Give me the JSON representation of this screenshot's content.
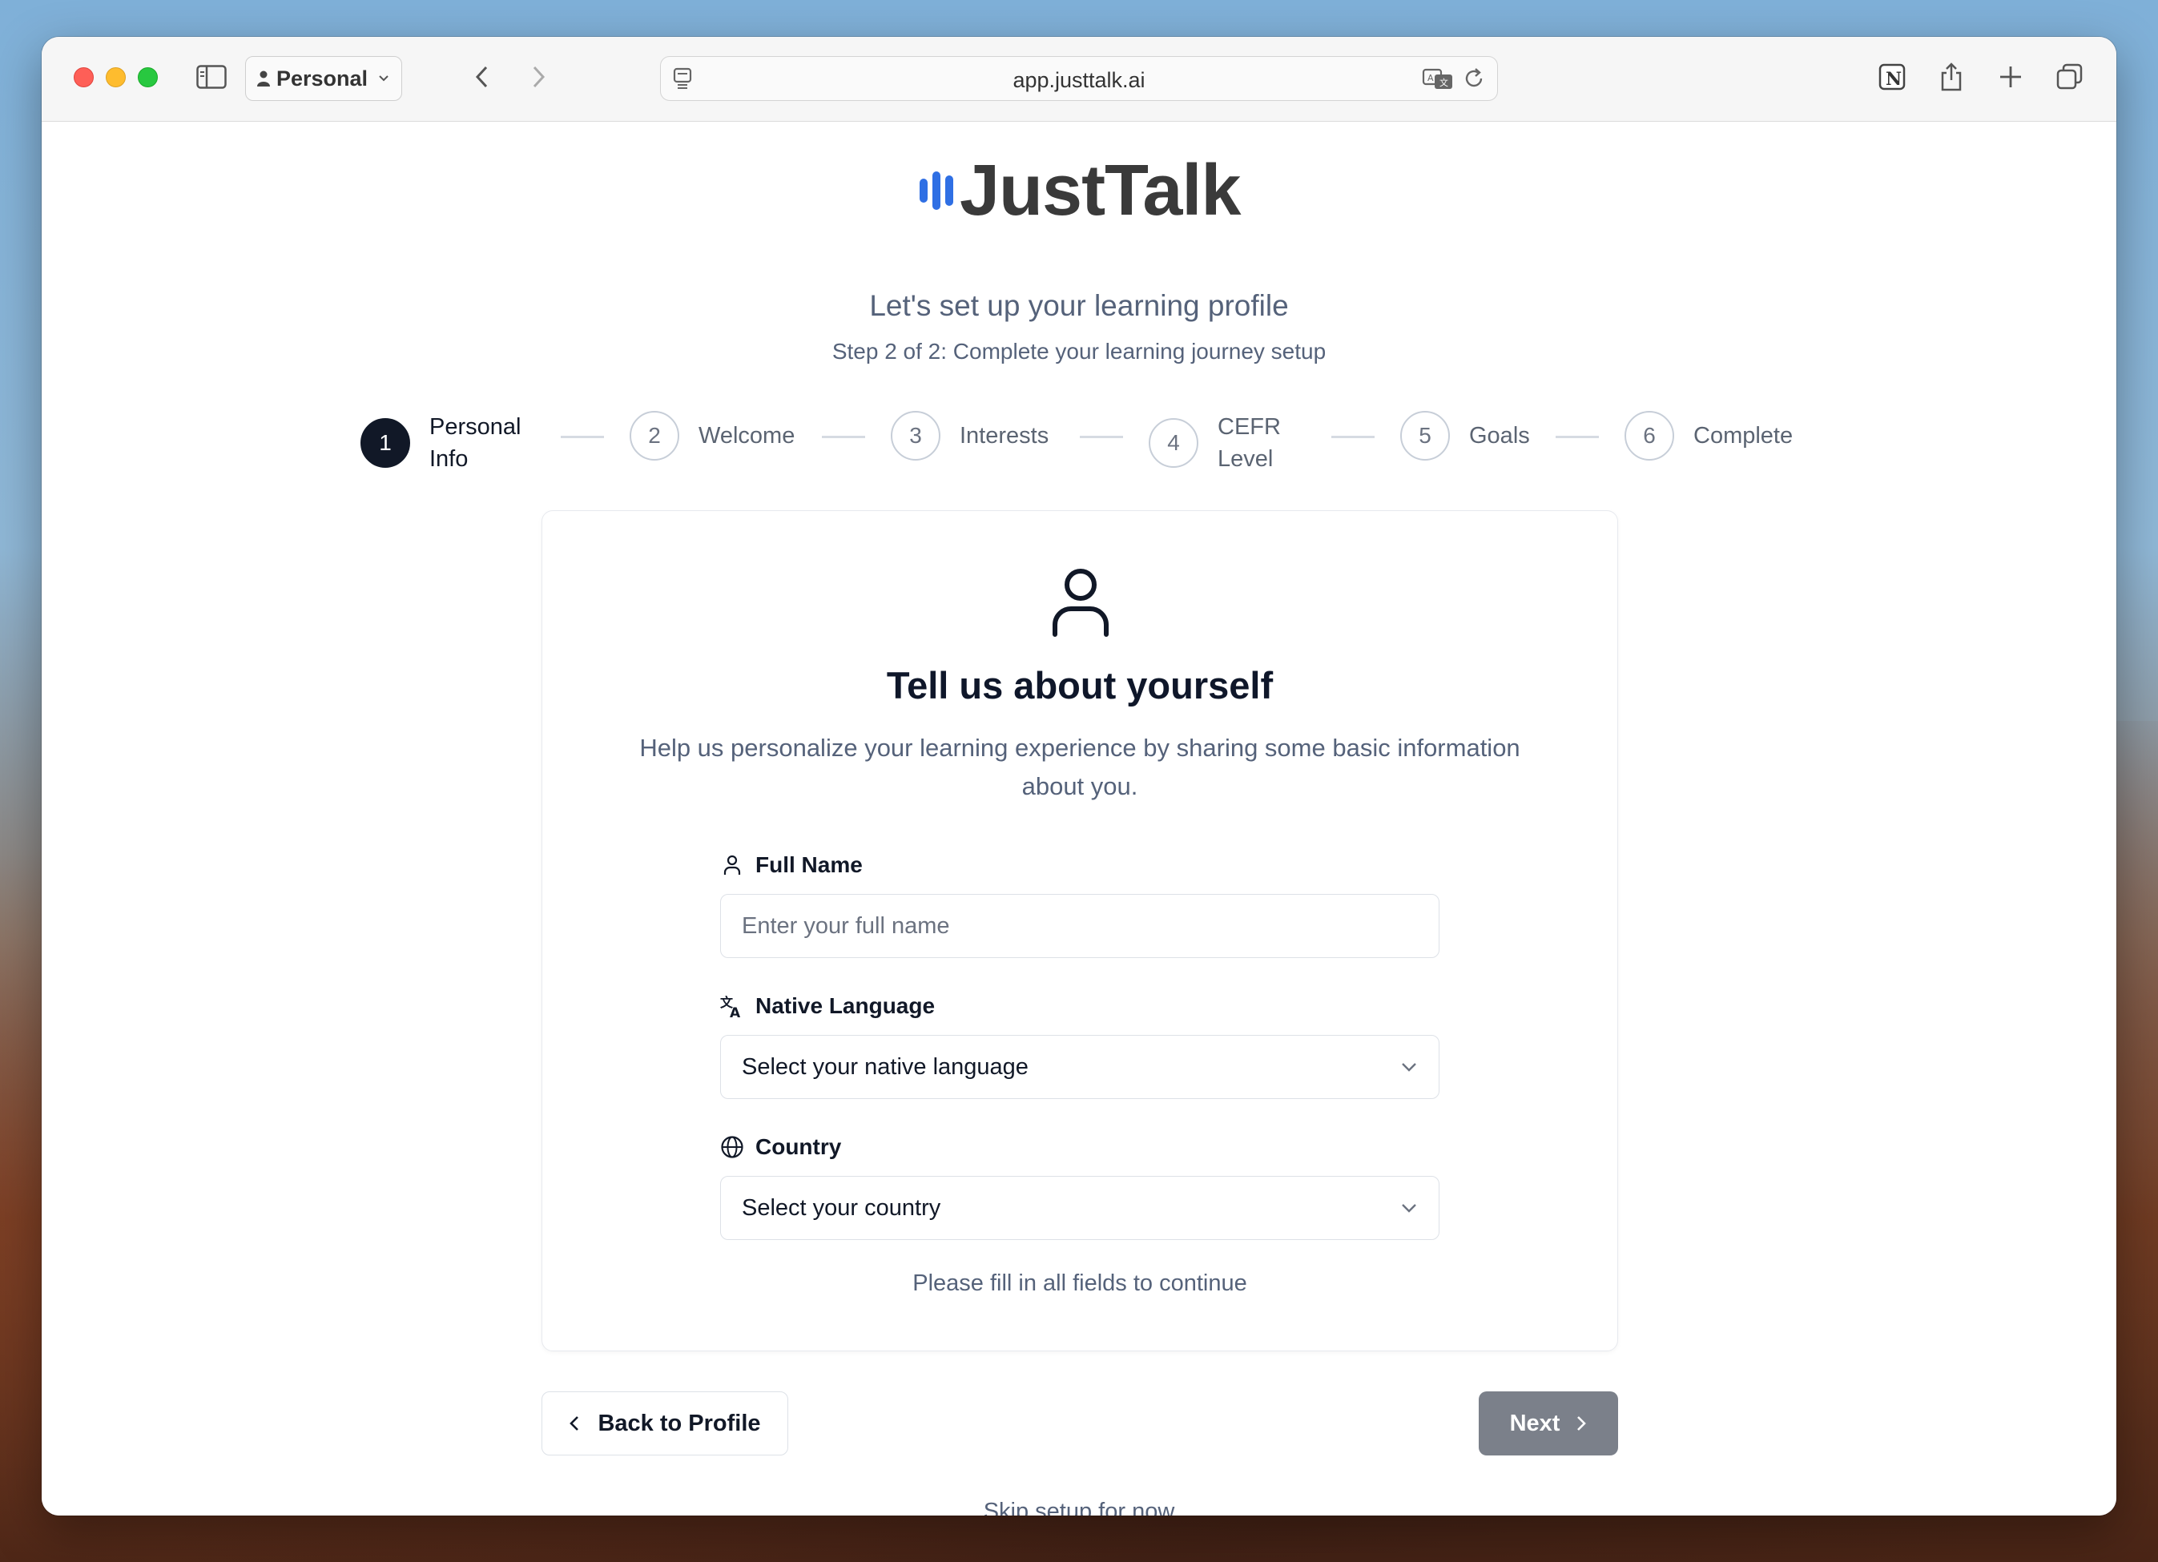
{
  "browser": {
    "profile_label": "Personal",
    "url": "app.justtalk.ai"
  },
  "app": {
    "logo_text": "JustTalk",
    "subtitle": "Let's set up your learning profile",
    "step_line": "Step 2 of 2: Complete your learning journey setup"
  },
  "stepper": {
    "steps": [
      {
        "number": "1",
        "label_line1": "Personal",
        "label_line2": "Info",
        "active": true
      },
      {
        "number": "2",
        "label_line1": "Welcome",
        "label_line2": "",
        "active": false
      },
      {
        "number": "3",
        "label_line1": "Interests",
        "label_line2": "",
        "active": false
      },
      {
        "number": "4",
        "label_line1": "CEFR",
        "label_line2": "Level",
        "active": false
      },
      {
        "number": "5",
        "label_line1": "Goals",
        "label_line2": "",
        "active": false
      },
      {
        "number": "6",
        "label_line1": "Complete",
        "label_line2": "",
        "active": false
      }
    ]
  },
  "card": {
    "title": "Tell us about yourself",
    "description": "Help us personalize your learning experience by sharing some basic information about you.",
    "full_name": {
      "label": "Full Name",
      "placeholder": "Enter your full name",
      "value": ""
    },
    "native_language": {
      "label": "Native Language",
      "selected": "Select your native language"
    },
    "country": {
      "label": "Country",
      "selected": "Select your country"
    },
    "fill_message": "Please fill in all fields to continue"
  },
  "actions": {
    "back_label": "Back to Profile",
    "next_label": "Next",
    "skip_label": "Skip setup for now"
  },
  "colors": {
    "brand_blue": "#2f6fe4",
    "active_step": "#111827",
    "next_disabled": "#7b808a"
  }
}
